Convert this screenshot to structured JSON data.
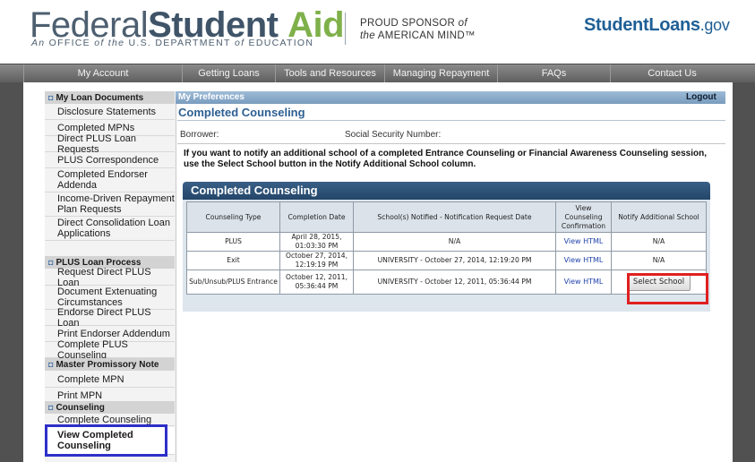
{
  "header": {
    "logo_word_1": "Federal",
    "logo_word_2": "Student",
    "logo_word_3": "Aid",
    "logo_sub_1": "An",
    "logo_sub_2": "OFFICE",
    "logo_sub_3": "of the",
    "logo_sub_4": "U.S. DEPARTMENT",
    "logo_sub_5": "of",
    "logo_sub_6": "EDUCATION",
    "sponsor_line_1": "PROUD SPONSOR",
    "sponsor_of": "of",
    "sponsor_line_2_pre": "the",
    "sponsor_line_2": "AMERICAN MIND™",
    "site_link_main": "StudentLoans",
    "site_link_suffix": ".gov"
  },
  "nav": {
    "items": [
      "My Account",
      "Getting Loans",
      "Tools and Resources",
      "Managing Repayment",
      "FAQs",
      "Contact Us"
    ]
  },
  "sidebar": {
    "sections": [
      {
        "title": "My Loan Documents",
        "items": [
          "Disclosure Statements",
          "Completed MPNs",
          "Direct PLUS Loan Requests",
          "PLUS Correspondence",
          "Completed Endorser Addenda",
          "Income-Driven Repayment Plan Requests",
          "Direct Consolidation Loan Applications"
        ]
      },
      {
        "title": "PLUS Loan Process",
        "items": [
          "Request Direct PLUS Loan",
          "Document Extenuating Circumstances",
          "Endorse Direct PLUS Loan",
          "Print Endorser Addendum",
          "Complete PLUS Counseling"
        ]
      },
      {
        "title": "Master Promissory Note",
        "items": [
          "Complete MPN",
          "Print MPN"
        ]
      },
      {
        "title": "Counseling",
        "items": [
          "Complete Counseling",
          "View Completed Counseling"
        ]
      }
    ],
    "bullet": "◘"
  },
  "prefs": {
    "title": "My Preferences",
    "logout": "Logout"
  },
  "main": {
    "page_title": "Completed Counseling",
    "borrower_label": "Borrower:",
    "ssn_label": "Social Security Number:",
    "instructions": "If you want to notify an additional school of a completed Entrance Counseling or Financial Awareness Counseling session, use the Select School button in the Notify Additional School column.",
    "panel_title": "Completed Counseling",
    "table": {
      "headers": [
        "Counseling Type",
        "Completion Date",
        "School(s) Notified - Notification Request Date",
        "View Counseling Confirmation",
        "Notify Additional School"
      ],
      "rows": [
        {
          "type": "PLUS",
          "date": "April 28, 2015, 01:03:30 PM",
          "schools": "N/A",
          "view": "View HTML",
          "notify": "N/A"
        },
        {
          "type": "Exit",
          "date": "October 27, 2014, 12:19:19 PM",
          "schools": "UNIVERSITY - October 27, 2014, 12:19:20 PM",
          "view": "View HTML",
          "notify": "N/A"
        },
        {
          "type": "Sub/Unsub/PLUS Entrance",
          "date": "October 12, 2011, 05:36:44 PM",
          "schools": "UNIVERSITY - October 12, 2011, 05:36:44 PM",
          "view": "View HTML",
          "notify": "Select School"
        }
      ]
    }
  },
  "colors": {
    "highlight_red": "#e01f1f",
    "highlight_blue": "#2d2fc8",
    "brand_blue": "#2d5f92",
    "brand_green": "#7fb04a"
  }
}
